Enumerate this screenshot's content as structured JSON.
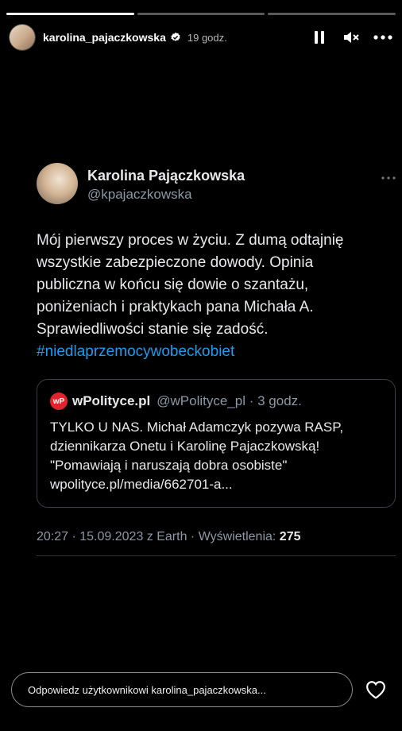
{
  "story": {
    "progress": [
      1.0,
      0.0,
      0.0
    ],
    "username": "karolina_pajaczkowska",
    "time": "19 godz.",
    "icons": {
      "avatar": "user-avatar",
      "verified": "verified-badge-icon",
      "pause": "pause-icon",
      "mute": "speaker-muted-icon",
      "more": "more-horizontal-icon"
    }
  },
  "tweet": {
    "author_name": "Karolina Pajączkowska",
    "author_handle": "@kpajaczkowska",
    "lines": [
      "Mój pierwszy proces w życiu. Z dumą odtajnię",
      "wszystkie zabezpieczone dowody. Opinia",
      "publiczna w końcu się dowie o szantażu,",
      "poniżeniach i praktykach pana Michała A.",
      "Sprawiedliwości stanie się zadość."
    ],
    "hashtag": "#niedlaprzemocywobeckobiet",
    "quote": {
      "logo_text": "wP",
      "name": "wPolityce.pl",
      "handle_time": "@wPolityce_pl · 3 godz.",
      "lines": [
        "TYLKO U NAS. Michał Adamczyk pozywa RASP,",
        "dziennikarza Onetu i Karolinę Pajaczkowską!",
        "\"Pomawiają i naruszają dobra osobiste\"",
        "wpolityce.pl/media/662701-a..."
      ]
    },
    "meta_text": "20:27 · 15.09.2023 z Earth · Wyświetlenia: ",
    "views": "275"
  },
  "reply": {
    "placeholder": "Odpowiedz użytkownikowi karolina_pajaczkowska..."
  },
  "colors": {
    "background": "#000000",
    "link": "#1d9bf0",
    "wpolityce_red": "#e0242b"
  }
}
